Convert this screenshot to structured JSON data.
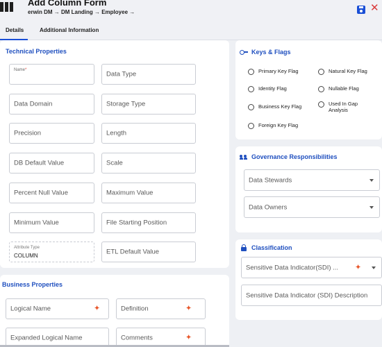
{
  "header": {
    "title": "Add Column Form",
    "breadcrumb": "erwin DM → DM Landing → Employee →"
  },
  "tabs": [
    "Details",
    "Additional Information"
  ],
  "technical": {
    "title": "Technical Properties",
    "name_label": "Name",
    "required_mark": "*",
    "data_type": "Data Type",
    "data_domain": "Data Domain",
    "storage_type": "Storage Type",
    "precision": "Precision",
    "length": "Length",
    "db_default": "DB Default Value",
    "scale": "Scale",
    "percent_null": "Percent Null Value",
    "maximum": "Maximum Value",
    "minimum": "Minimum Value",
    "file_start": "File Starting Position",
    "attribute_type_label": "Attribute Type",
    "attribute_type_value": "COLUMN",
    "etl_default": "ETL Default Value"
  },
  "business": {
    "title": "Business Properties",
    "logical_name": "Logical Name",
    "definition": "Definition",
    "expanded_logical_name": "Expanded Logical Name",
    "comments": "Comments"
  },
  "keys": {
    "title": "Keys & Flags",
    "flags": [
      "Primary Key Flag",
      "Natural Key Flag",
      "Identity Flag",
      "Nullable Flag",
      "Business Key Flag",
      "Used In Gap Analysis",
      "Foreign Key Flag"
    ]
  },
  "governance": {
    "title": "Governance Responsibilities",
    "data_stewards": "Data Stewards",
    "data_owners": "Data Owners"
  },
  "classification": {
    "title": "Classification",
    "sdi": "Sensitive Data Indicator(SDI) ...",
    "sdi_description": "Sensitive Data Indicator (SDI) Description"
  },
  "colors": {
    "accent": "#1f4fbf",
    "sparkle": "#e8572b",
    "close": "#d93a3a",
    "required": "#e0463c"
  }
}
